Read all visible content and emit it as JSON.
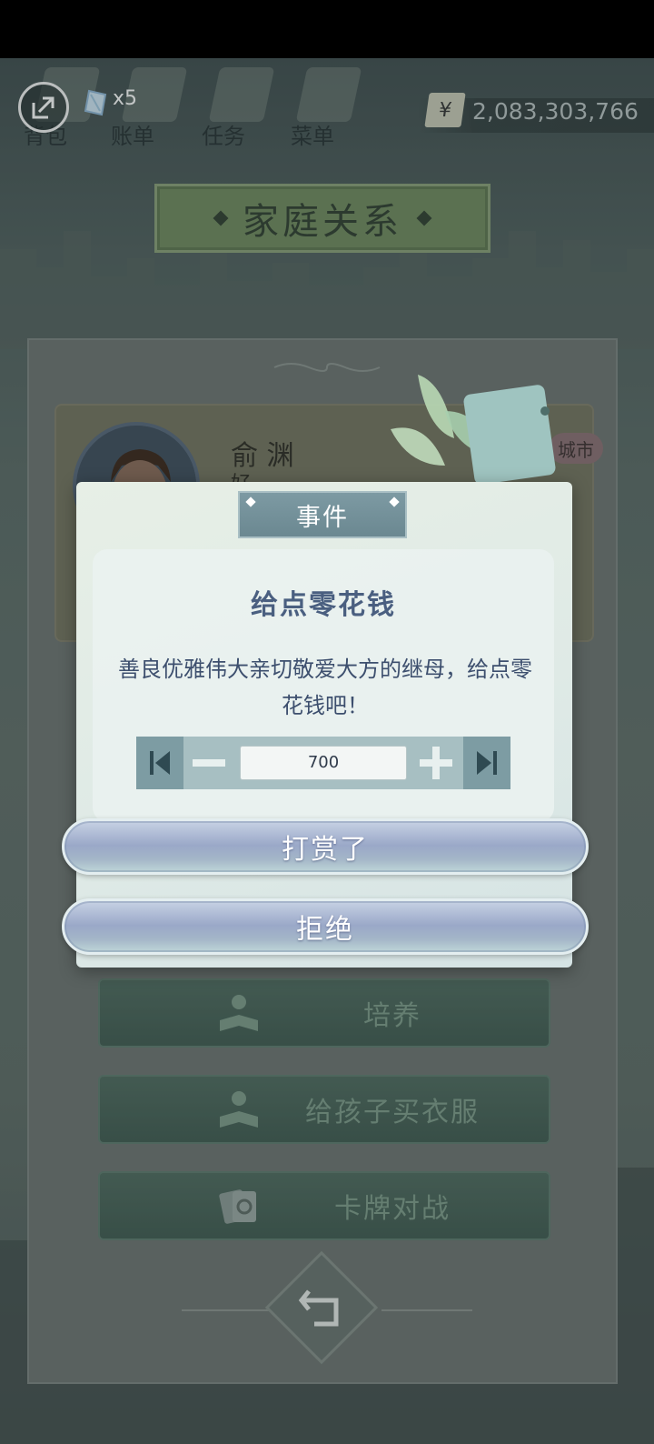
{
  "hud": {
    "tabs": [
      "背包",
      "账单",
      "任务",
      "菜单"
    ],
    "gem_count": "x5",
    "currency_symbol": "¥",
    "money": "2,083,303,766"
  },
  "page_title": "家庭关系",
  "profile": {
    "name": "俞 渊",
    "subtitle": "好",
    "city_tag": "城市"
  },
  "dialog": {
    "tab_label": "事件",
    "title": "给点零花钱",
    "message": "善良优雅伟大亲切敬爱大方的继母，给点零花钱吧！",
    "amount": "700",
    "confirm_label": "打赏了",
    "reject_label": "拒绝"
  },
  "actions": [
    "培养",
    "给孩子买衣服",
    "卡牌对战"
  ],
  "colors": {
    "title_banner": "#6f8a5e",
    "dialog_title": "#4a5f80",
    "pill_button": "#9aa8c8",
    "action_button": "#4e6a5e"
  }
}
